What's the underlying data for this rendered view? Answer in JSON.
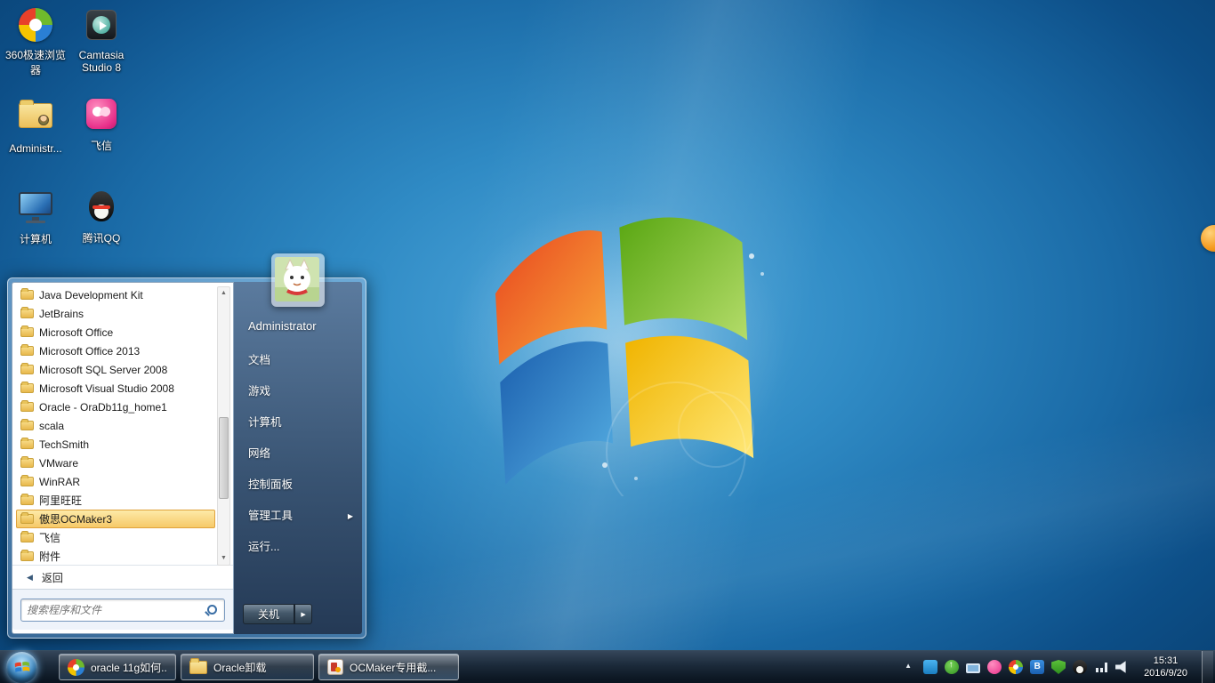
{
  "desktop_icons": [
    {
      "label": "360极速浏览器"
    },
    {
      "label": "Camtasia Studio 8"
    },
    {
      "label": "Administr..."
    },
    {
      "label": "飞信"
    },
    {
      "label": "计算机"
    },
    {
      "label": "腾讯QQ"
    }
  ],
  "start_menu": {
    "programs": [
      "Java Development Kit",
      "JetBrains",
      "Microsoft Office",
      "Microsoft Office 2013",
      "Microsoft SQL Server 2008",
      "Microsoft Visual Studio 2008",
      "Oracle - OraDb11g_home1",
      "scala",
      "TechSmith",
      "VMware",
      "WinRAR",
      "阿里旺旺",
      "傲思OCMaker3",
      "飞信",
      "附件"
    ],
    "selected_program": "傲思OCMaker3",
    "back_label": "返回",
    "search_placeholder": "搜索程序和文件",
    "user_name": "Administrator",
    "right_items": [
      "文档",
      "游戏",
      "计算机",
      "网络",
      "控制面板",
      "管理工具",
      "运行..."
    ],
    "shutdown_label": "关机"
  },
  "taskbar": {
    "buttons": [
      {
        "label": "oracle 11g如何..."
      },
      {
        "label": "Oracle卸载"
      },
      {
        "label": "OCMaker专用截..."
      }
    ],
    "tray_icon_names": [
      "hidden-icons-arrow",
      "wangwang-icon",
      "upload-icon",
      "display-icon",
      "fetion-icon",
      "360-browser-icon",
      "bluetooth-icon",
      "360safe-shield-icon",
      "qq-icon",
      "network-icon",
      "volume-icon"
    ],
    "clock": {
      "time": "15:31",
      "date": "2016/9/20"
    }
  },
  "brand_colors": {
    "orange": "#f0582b",
    "green": "#6fb41c",
    "blue": "#2a7fd4",
    "yellow": "#f5c400"
  }
}
